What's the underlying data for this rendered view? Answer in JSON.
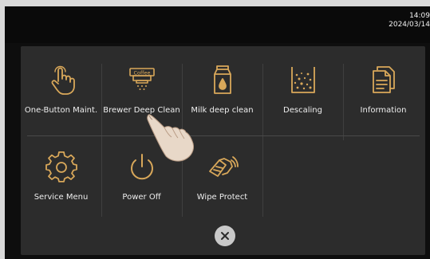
{
  "status": {
    "time": "14:09",
    "date": "2024/03/14"
  },
  "menu": {
    "items": [
      {
        "label": "One-Button Maint.",
        "icon": "tap-finger-icon"
      },
      {
        "label": "Brewer Deep Clean",
        "icon": "coffee-brewer-icon",
        "icon_text": "Coffee"
      },
      {
        "label": "Milk deep clean",
        "icon": "milk-carton-icon"
      },
      {
        "label": "Descaling",
        "icon": "descaling-beaker-icon"
      },
      {
        "label": "Information",
        "icon": "documents-icon"
      },
      {
        "label": "Service Menu",
        "icon": "gear-icon"
      },
      {
        "label": "Power Off",
        "icon": "power-icon"
      },
      {
        "label": "Wipe Protect",
        "icon": "wipe-hand-icon"
      }
    ]
  },
  "colors": {
    "accent": "#d9a85a",
    "panel": "#2c2c2c",
    "screen": "#0e0e0e",
    "text": "#eeeeee"
  }
}
